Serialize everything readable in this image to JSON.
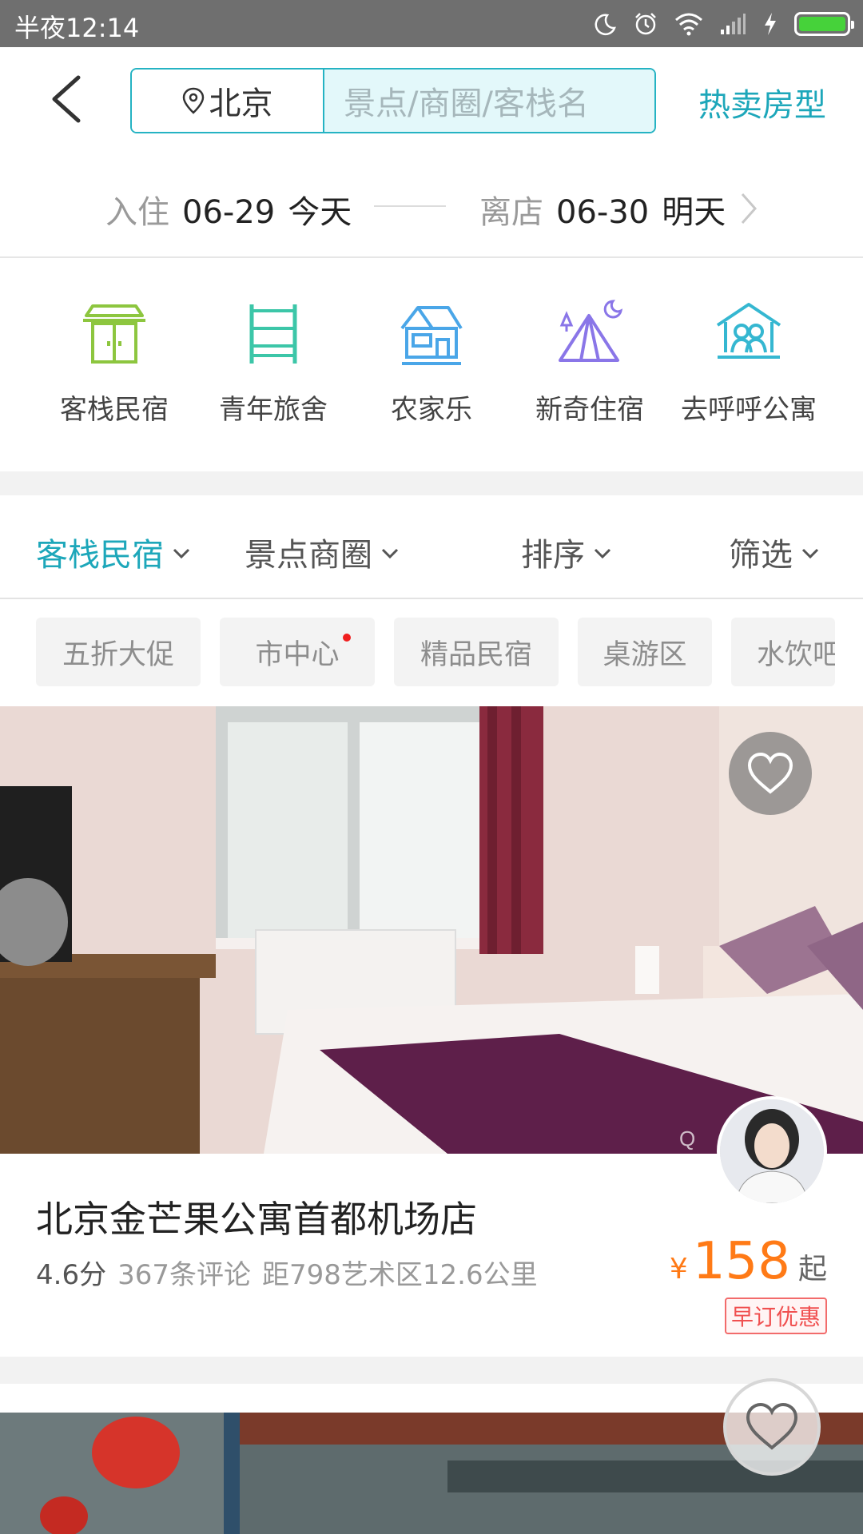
{
  "status_bar": {
    "time": "半夜12:14",
    "battery_level": 1.0
  },
  "header": {
    "city": "北京",
    "search_placeholder": "景点/商圈/客栈名",
    "hot_link": "热卖房型"
  },
  "dates": {
    "checkin_label": "入住",
    "checkin_date": "06-29",
    "checkin_rel": "今天",
    "checkout_label": "离店",
    "checkout_date": "06-30",
    "checkout_rel": "明天"
  },
  "categories": [
    {
      "label": "客栈民宿",
      "icon": "inn-icon",
      "color": "#8dc63f"
    },
    {
      "label": "青年旅舍",
      "icon": "bunk-bed-icon",
      "color": "#3cc6a8"
    },
    {
      "label": "农家乐",
      "icon": "farmhouse-icon",
      "color": "#4aa6e8"
    },
    {
      "label": "新奇住宿",
      "icon": "tent-icon",
      "color": "#8a76e8"
    },
    {
      "label": "去呼呼公寓",
      "icon": "apartment-icon",
      "color": "#35b7d1"
    }
  ],
  "filters": [
    {
      "label": "客栈民宿",
      "active": true
    },
    {
      "label": "景点商圈",
      "active": false
    },
    {
      "label": "排序",
      "active": false
    },
    {
      "label": "筛选",
      "active": false
    }
  ],
  "tags": [
    "五折大促",
    "市中心",
    "精品民宿",
    "桌游区",
    "水饮吧"
  ],
  "listing": {
    "title": "北京金芒果公寓首都机场店",
    "score": "4.6分",
    "reviews": "367条评论",
    "distance": "距798艺术区12.6公里",
    "currency": "¥",
    "price": "158",
    "price_suffix": "起",
    "promo": "早订优惠"
  },
  "colors": {
    "accent": "#1da7ba",
    "price": "#ff7a16",
    "promo": "#f05050"
  }
}
